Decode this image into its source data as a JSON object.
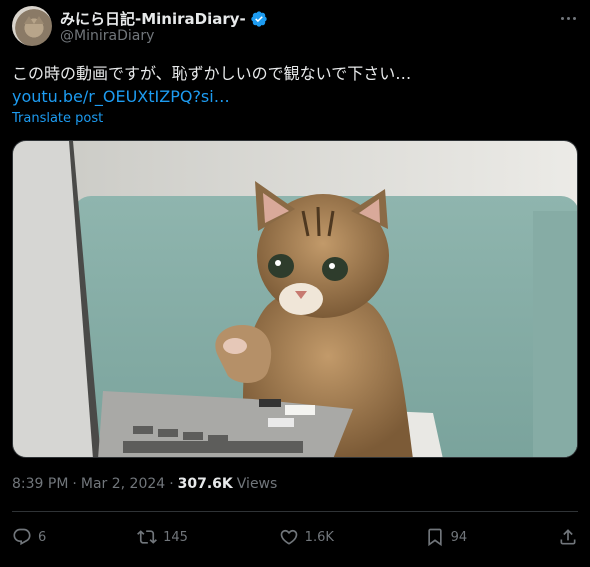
{
  "author": {
    "display_name": "みにら日記-MiniraDiary-",
    "handle": "@MiniraDiary"
  },
  "post": {
    "text": "この時の動画ですが、恥ずかしいので観ないで下さい…",
    "link": "youtu.be/r_OEUXtIZPQ?si…",
    "translate_label": "Translate post"
  },
  "meta": {
    "time": "8:39 PM",
    "sep1": "·",
    "date": "Mar 2, 2024",
    "sep2": "·",
    "views_count": "307.6K",
    "views_label": "Views"
  },
  "actions": {
    "replies": "6",
    "reposts": "145",
    "likes": "1.6K",
    "bookmarks": "94"
  },
  "colors": {
    "accent": "#1d9bf0",
    "secondary_text": "#71767b",
    "background": "#000000"
  }
}
